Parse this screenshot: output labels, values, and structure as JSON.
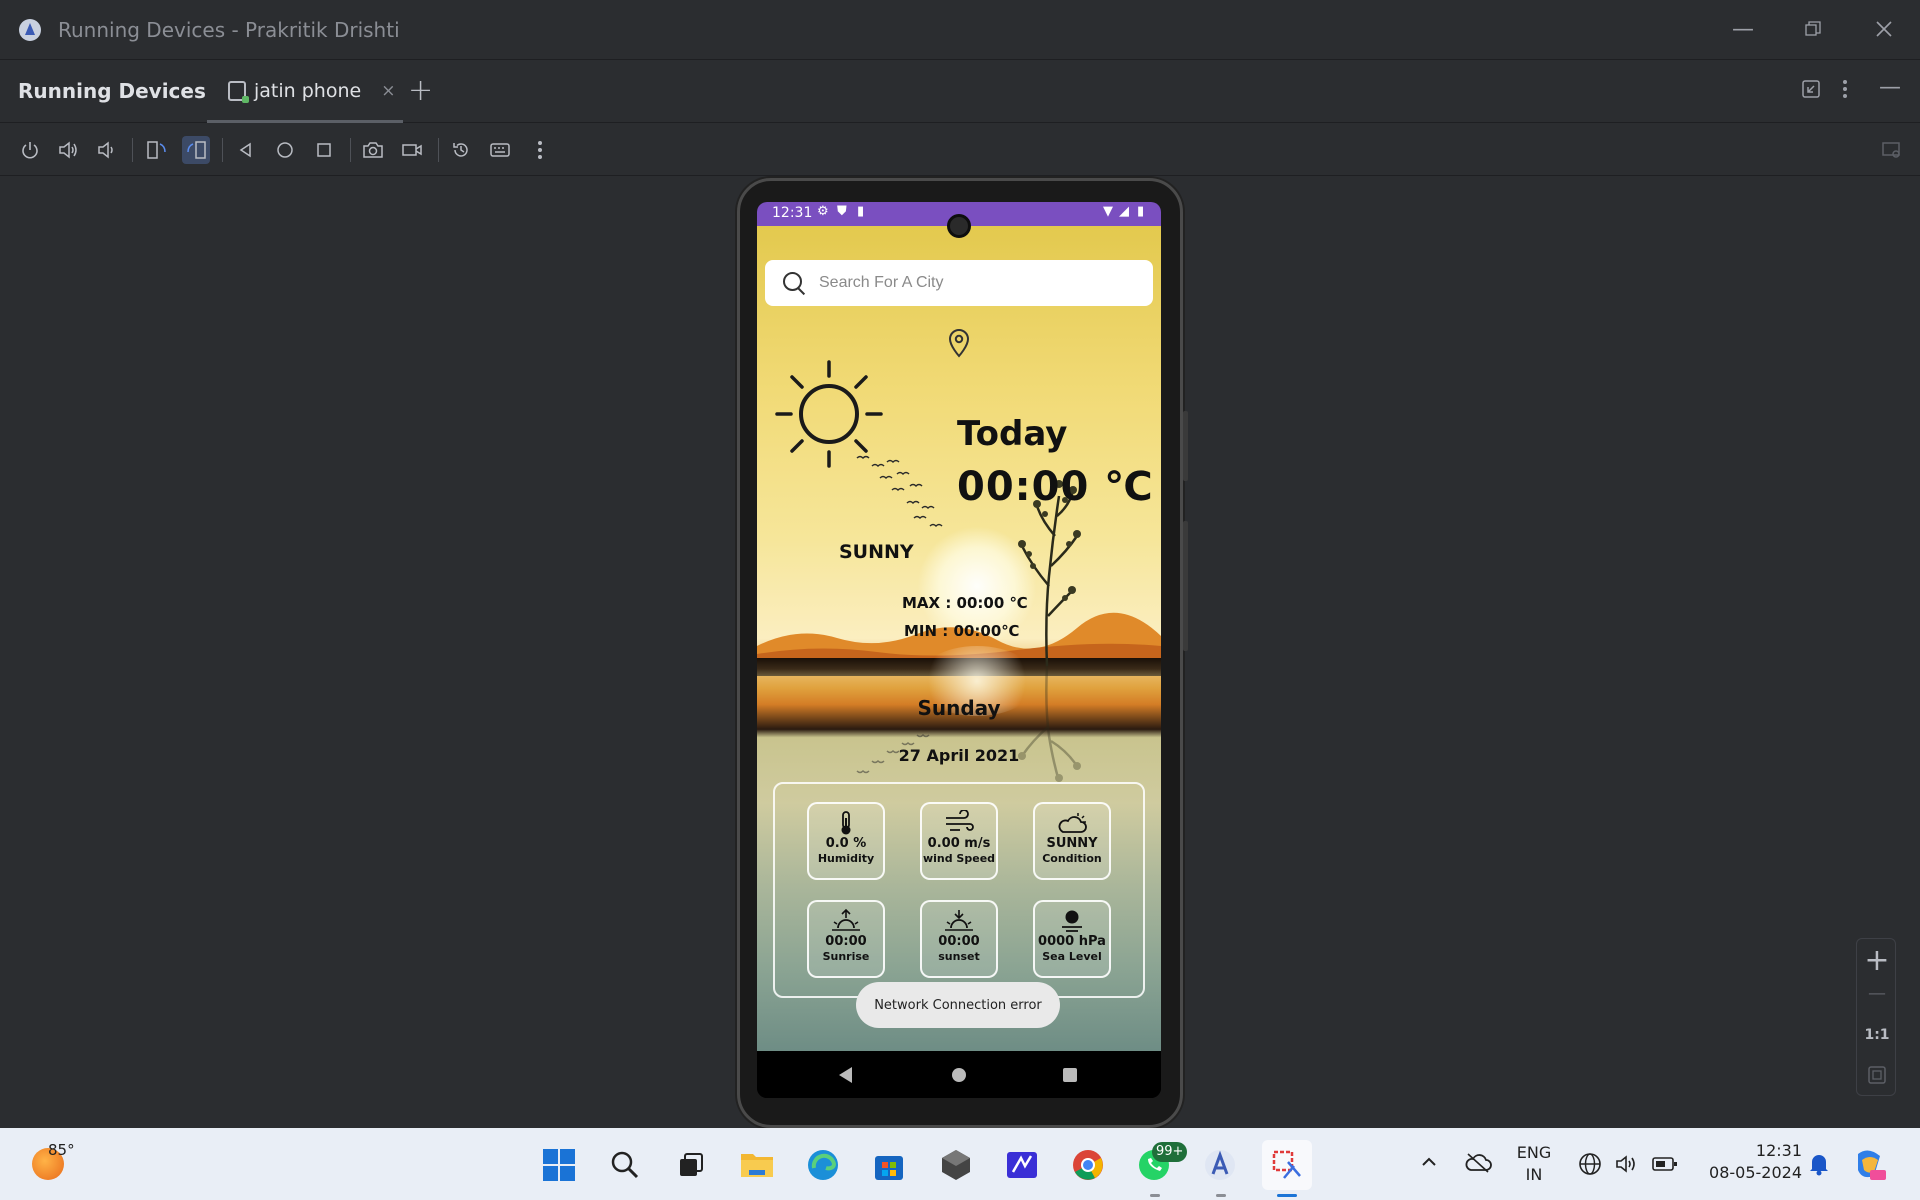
{
  "window": {
    "title": "Running Devices - Prakritik Drishti"
  },
  "tool_window": {
    "title": "Running Devices",
    "tab_label": "jatin phone",
    "tab_close": "×",
    "add_tab": "+"
  },
  "device": {
    "status_time": "12:31",
    "search_placeholder": "Search For A City",
    "today_label": "Today",
    "temperature": "00:00 ℃",
    "condition": "SUNNY",
    "max": "MAX : 00:00 ℃",
    "min": "MIN :  00:00℃",
    "day": "Sunday",
    "date": "27 April 2021",
    "cards": [
      {
        "icon": "thermometer-icon",
        "value": "0.0 %",
        "label": "Humidity"
      },
      {
        "icon": "wind-icon",
        "value": "0.00 m/s",
        "label": "wind Speed"
      },
      {
        "icon": "cloud-sun-icon",
        "value": "SUNNY",
        "label": "Condition"
      },
      {
        "icon": "sunrise-icon",
        "value": "00:00",
        "label": "Sunrise"
      },
      {
        "icon": "sunset-icon",
        "value": "00:00",
        "label": "sunset"
      },
      {
        "icon": "sea-level-icon",
        "value": "0000 hPa",
        "label": "Sea Level"
      }
    ],
    "toast": "Network Connection error"
  },
  "zoom": {
    "plus": "+",
    "minus": "—",
    "one_to_one": "1:1"
  },
  "taskbar": {
    "weather_temp": "85°",
    "whatsapp_badge": "99+",
    "lang_top": "ENG",
    "lang_bottom": "IN",
    "clock_time": "12:31",
    "clock_date": "08-05-2024"
  }
}
